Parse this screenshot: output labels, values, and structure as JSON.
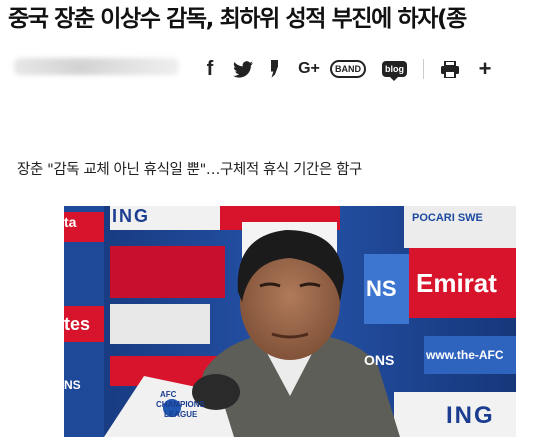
{
  "article": {
    "headline": "중국 장춘 이상수 감독, 최하위 성적 부진에 하자(종",
    "subheadline": "장춘 \"감독 교체 아닌 휴식일 뿐\"…구체적 휴식 기간은 함구"
  },
  "share": {
    "facebook": "f",
    "googleplus": "G+",
    "band": "BAND",
    "blog": "blog",
    "more": "+"
  },
  "photo": {
    "sponsor_ing": "ING",
    "sponsor_pocari": "POCARI SWE",
    "sponsor_emirates": "Emirat",
    "url_text": "www.the-AFC",
    "mic_badge_1": "AFC",
    "mic_badge_2": "CHAMPIONS",
    "mic_badge_3": "LEAGUE",
    "board_left_1": "ta",
    "board_left_2": "tes",
    "board_left_3": "NS",
    "board_right_1": "NS",
    "board_right_2": "ONS",
    "board_bottom": "ING"
  },
  "colors": {
    "headline": "#111111",
    "backdrop_blue": "#1d3f82",
    "emirates_red": "#d7142b",
    "jacket": "#5d5e58"
  }
}
